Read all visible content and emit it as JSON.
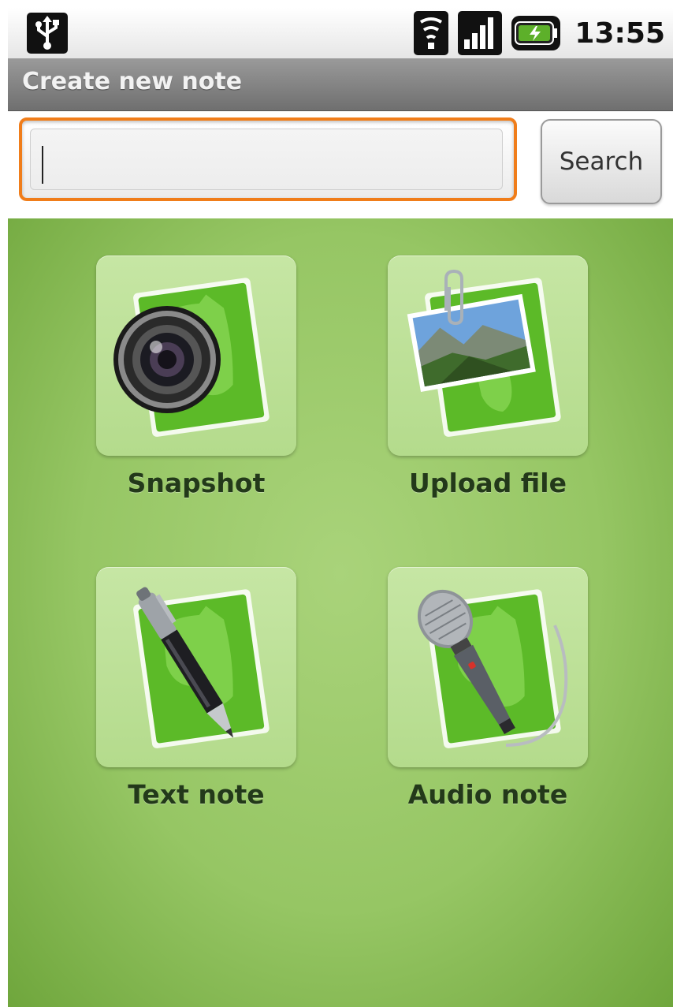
{
  "status_bar": {
    "time": "13:55",
    "icons": [
      "usb-icon",
      "wifi-icon",
      "signal-icon",
      "battery-icon"
    ]
  },
  "title_bar": {
    "title": "Create new note"
  },
  "search": {
    "value": "",
    "placeholder": "",
    "button_label": "Search"
  },
  "tiles": [
    {
      "label": "Snapshot",
      "icon": "camera-icon"
    },
    {
      "label": "Upload file",
      "icon": "photo-attachment-icon"
    },
    {
      "label": "Text note",
      "icon": "pen-icon"
    },
    {
      "label": "Audio note",
      "icon": "microphone-icon"
    }
  ],
  "colors": {
    "accent": "#f07d1a",
    "background_green": "#96c664",
    "tile_green": "#b4db8c",
    "note_green": "#5cba28",
    "label_text": "#23391a"
  }
}
